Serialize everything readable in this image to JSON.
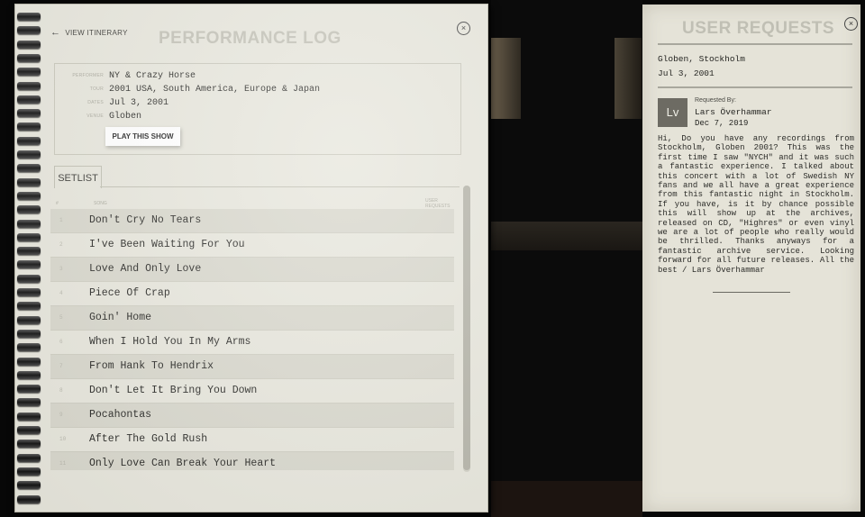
{
  "header": {
    "back_label": "VIEW ITINERARY",
    "title": "PERFORMANCE LOG",
    "close_symbol": "×"
  },
  "performance": {
    "performer_label": "PERFORMER",
    "performer": "NY & Crazy Horse",
    "tour_label": "TOUR",
    "tour": "2001 USA, South America, Europe & Japan",
    "dates_label": "DATES",
    "date": "Jul 3, 2001",
    "venue_label": "VENUE",
    "venue": "Globen",
    "play_button": "PLAY THIS SHOW"
  },
  "setlist": {
    "tab_label": "SETLIST",
    "col_number": "#",
    "col_song": "SONG",
    "col_requests": "USER REQUESTS",
    "songs": [
      {
        "num": "1",
        "title": "Don't Cry No Tears"
      },
      {
        "num": "2",
        "title": "I've Been Waiting For You"
      },
      {
        "num": "3",
        "title": "Love And Only Love"
      },
      {
        "num": "4",
        "title": "Piece Of Crap"
      },
      {
        "num": "5",
        "title": "Goin' Home"
      },
      {
        "num": "6",
        "title": "When I Hold You In My Arms"
      },
      {
        "num": "7",
        "title": "From Hank To Hendrix"
      },
      {
        "num": "8",
        "title": "Don't Let It Bring You Down"
      },
      {
        "num": "9",
        "title": "Pocahontas"
      },
      {
        "num": "10",
        "title": "After The Gold Rush"
      },
      {
        "num": "11",
        "title": "Only Love Can Break Your Heart"
      }
    ]
  },
  "requests": {
    "title": "USER REQUESTS",
    "close_symbol": "×",
    "location": "Globen, Stockholm",
    "date": "Jul 3, 2001",
    "avatar_initials": "Lv",
    "requested_by_label": "Requested By:",
    "requester": "Lars Överhammar",
    "request_date": "Dec 7, 2019",
    "message": "Hi, Do you have any recordings from Stockholm, Globen 2001? This was the first time I saw \"NYCH\" and it was such a fantastic experience. I talked about this concert with a lot of Swedish NY fans and we all have a great experience from this fantastic night in Stockholm. If you have, is it by chance possible this will show up at the archives, released on CD, \"Highres\" or even vinyl we are a lot of people who really would be thrilled. Thanks anyways for a fantastic archive service. Looking forward for all future releases. All the best / Lars Överhammar"
  }
}
